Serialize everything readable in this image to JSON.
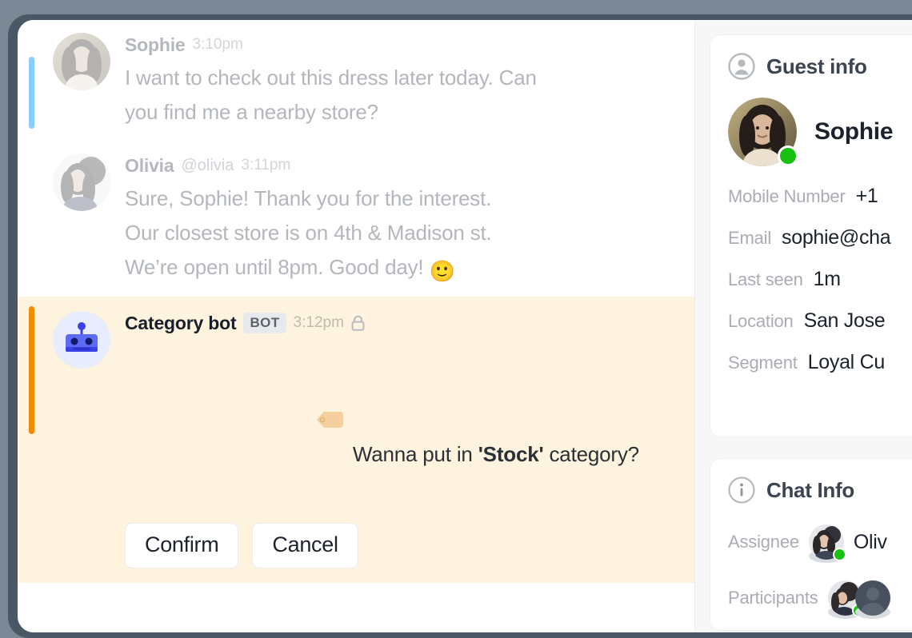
{
  "theme": {
    "frame_color": "#4a5866",
    "page_background": "#7a8794",
    "bot_message_background": "#fdf3de",
    "bot_accent_color": "#f08c00",
    "guest_accent_color": "#87cefa",
    "online_color": "#16c20f",
    "sidebar_background": "#f7f7f8"
  },
  "messages": [
    {
      "author": "Sophie",
      "handle": "",
      "timestamp": "3:10pm",
      "text": "I want to check out this dress later today. Can\nyou find me a nearby store?",
      "accent": "#87cefa",
      "state": "read"
    },
    {
      "author": "Olivia",
      "handle": "@olivia",
      "timestamp": "3:11pm",
      "text": "Sure, Sophie! Thank you for the interest.\nOur closest store is on 4th & Madison st.\nWe’re open until 8pm. Good day! ",
      "emoji": "🙂",
      "accent": "",
      "state": "read"
    }
  ],
  "bot_message": {
    "author": "Category bot",
    "badge": "BOT",
    "timestamp": "3:12pm",
    "lock_icon": "lock-icon",
    "tag_icon": "tag-icon",
    "text_before": "Wanna put in ",
    "text_strong": "'Stock'",
    "text_after": " category?",
    "buttons": [
      {
        "label": "Confirm",
        "name": "confirm-button"
      },
      {
        "label": "Cancel",
        "name": "cancel-button"
      }
    ]
  },
  "guest_info": {
    "title": "Guest info",
    "icon": "person-circle-icon",
    "name": "Sophie",
    "status": "online",
    "fields": [
      {
        "label": "Mobile Number",
        "value": "+1"
      },
      {
        "label": "Email",
        "value": "sophie@cha"
      },
      {
        "label": "Last seen",
        "value": "1m"
      },
      {
        "label": "Location",
        "value": "San Jose"
      },
      {
        "label": "Segment",
        "value": "Loyal Cu"
      }
    ]
  },
  "chat_info": {
    "title": "Chat Info",
    "icon": "info-circle-icon",
    "assignee": {
      "label": "Assignee",
      "name": "Oliv"
    },
    "participants": {
      "label": "Participants",
      "count": 2
    }
  }
}
